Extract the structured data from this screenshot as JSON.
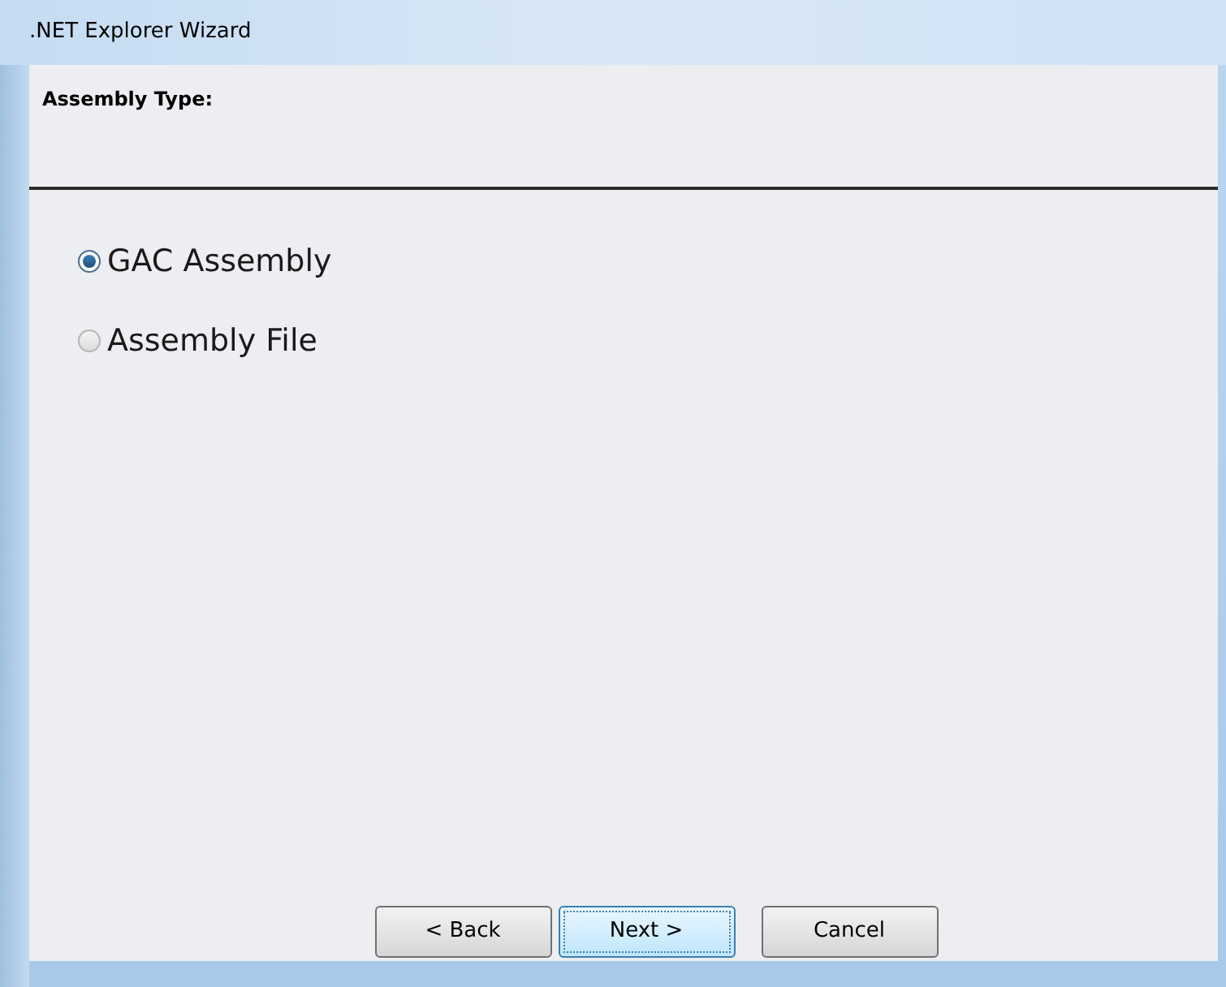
{
  "window": {
    "title": ".NET Explorer Wizard"
  },
  "header": {
    "title": "Assembly Type:"
  },
  "options": [
    {
      "label": "GAC Assembly",
      "selected": true
    },
    {
      "label": "Assembly File",
      "selected": false
    }
  ],
  "buttons": [
    {
      "label": "< Back",
      "focused": false
    },
    {
      "label": "Next >",
      "focused": true
    },
    {
      "label": "Cancel",
      "focused": false
    }
  ]
}
